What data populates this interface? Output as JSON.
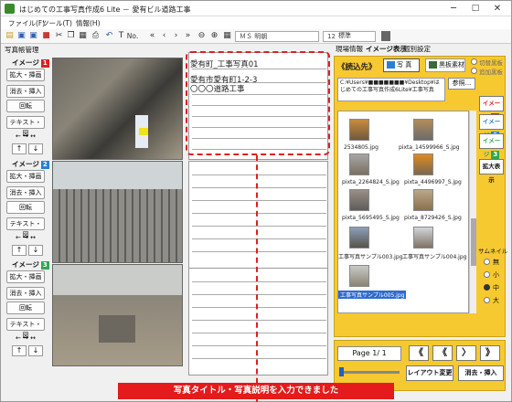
{
  "window": {
    "title": "はじめての工事写真作成6 Lite － 愛有ビル道路工事",
    "minimize": "─",
    "maximize": "□",
    "close": "✕"
  },
  "menu": {
    "file": "ファイル(F)",
    "tools": "ツール(T)",
    "info": "情報(H)"
  },
  "toolbar": {
    "no_label": "No.",
    "font": "ＭＳ 明朝",
    "size": "12",
    "style": "標準"
  },
  "left": {
    "panel_tab": "写真帳管理",
    "images": [
      {
        "label": "イメージ",
        "num": "1",
        "badge_color": "#e02020"
      },
      {
        "label": "イメージ",
        "num": "2",
        "badge_color": "#2a7fd4"
      },
      {
        "label": "イメージ",
        "num": "3",
        "badge_color": "#2fa84f"
      }
    ],
    "enlarge_insert": "拡大・挿画",
    "delete_insert": "消去・挿入",
    "rotate": "回転",
    "text": "テキスト・図",
    "lr": "← → ↔",
    "up": "↑",
    "down": "↓"
  },
  "photo_entry": {
    "title": "愛有町_工事写真01",
    "address": "愛有市愛有町1-2-3",
    "work": "〇〇〇道路工事"
  },
  "right": {
    "tabs": [
      "現場情報",
      "イメージ表示",
      "個別設定"
    ],
    "read_label": "《読込先》",
    "src_photo": "写 真",
    "src_material": "黒板素材",
    "opt_all": "切替黒板",
    "opt_add": "追加黒板",
    "ref_button": "参照...",
    "path": "C:¥Users¥■■■■■■■¥Desktop¥はじめての工事写真作成6Lite¥工事写真",
    "thumbs": [
      "2534805.jpg",
      "pixta_14599966_S.jpg",
      "pixta_2264824_S.jpg",
      "pixta_4496997_S.jpg",
      "pixta_5695495_S.jpg",
      "pixta_8729426_S.jpg",
      "工事写真サンプル003.jpg",
      "工事写真サンプル004.jpg",
      "工事写真サンプル005.jpg"
    ],
    "img_btns": [
      {
        "label": "イメージ",
        "num": "1"
      },
      {
        "label": "イメージ",
        "num": "2"
      },
      {
        "label": "イメージ",
        "num": "3"
      }
    ],
    "enlarge_display": "拡大表示",
    "thumbnail_size": "サムネイル",
    "sizes": [
      "無",
      "小",
      "中",
      "大"
    ]
  },
  "bottom": {
    "page": "Page 1/ 1",
    "first": "《",
    "prev": "《",
    "next": "〉",
    "last": "》",
    "layout_change": "レイアウト変更",
    "delete_insert": "消去・挿入"
  },
  "caption": "写真タイトル・写真説明を入力できました"
}
